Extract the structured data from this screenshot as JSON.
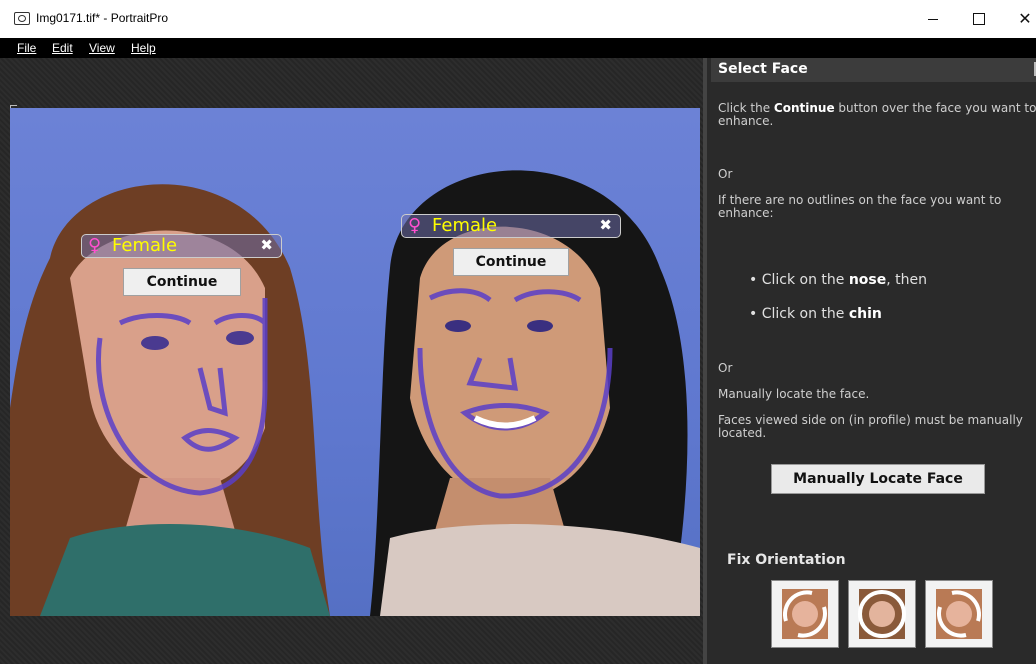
{
  "window": {
    "title": "Img0171.tif* - PortraitPro",
    "minimize": "–",
    "maximize": "☐",
    "close": "✕"
  },
  "menu": [
    "File",
    "Edit",
    "View",
    "Help"
  ],
  "faces": [
    {
      "gender": "Female",
      "close": "✖",
      "continue": "Continue"
    },
    {
      "gender": "Female",
      "close": "✖",
      "continue": "Continue"
    }
  ],
  "panel": {
    "title": "Select Face",
    "instr_pre": "Click the ",
    "instr_bold": "Continue",
    "instr_post": " button over the face you want to enhance.",
    "or1": "Or",
    "no_outline": "If there are no outlines on the face you want to enhance:",
    "bullet1_pre": "• Click on the ",
    "bullet1_bold": "nose",
    "bullet1_post": ", then",
    "bullet2_pre": "• Click on the ",
    "bullet2_bold": "chin",
    "or2": "Or",
    "manual": "Manually locate the face.",
    "profile": "Faces viewed side on (in profile) must be manually located.",
    "manual_button": "Manually Locate Face",
    "fix_orientation": "Fix Orientation"
  },
  "icons": {
    "app": "camera-icon",
    "venus": "venus-icon",
    "rotate_left": "rotate-left-icon",
    "flip": "rotate-180-icon",
    "rotate_right": "rotate-right-icon"
  },
  "colors": {
    "background_blue": "#6c82d6",
    "outline": "#5a3fc8",
    "tag_text": "#ffff00",
    "venus": "#ff4fd0"
  }
}
